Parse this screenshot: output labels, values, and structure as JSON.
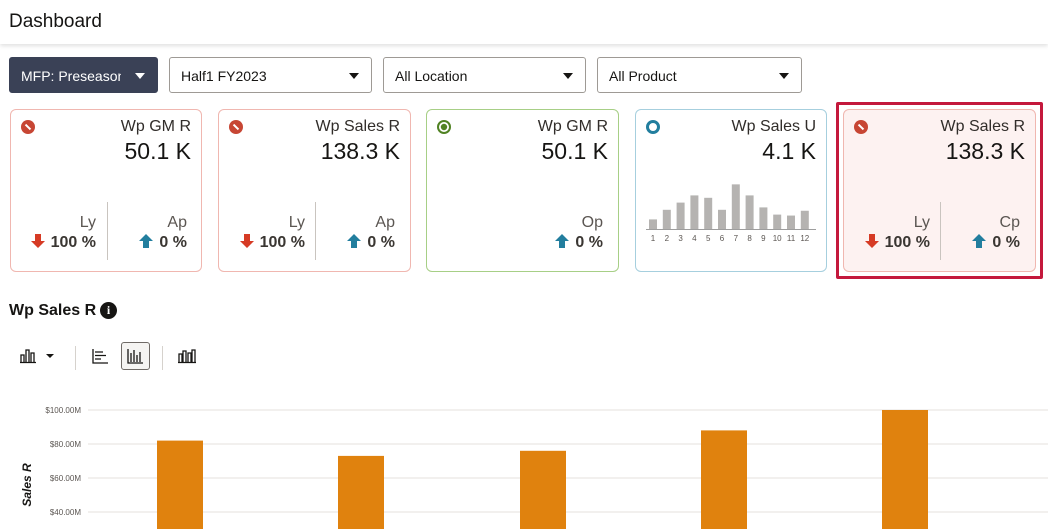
{
  "page": {
    "title": "Dashboard"
  },
  "filters": {
    "plan": "MFP: Preseason",
    "period": "Half1 FY2023",
    "location": "All Location",
    "product": "All Product"
  },
  "tiles": [
    {
      "name": "Wp GM R",
      "value": "50.1 K",
      "status": "no-entry-red",
      "color": "#c74634",
      "comparisons": [
        {
          "label": "Ly",
          "pct": "100 %",
          "dir": "down"
        },
        {
          "label": "Ap",
          "pct": "0 %",
          "dir": "up"
        }
      ]
    },
    {
      "name": "Wp Sales R",
      "value": "138.3 K",
      "status": "no-entry-red",
      "color": "#c74634",
      "comparisons": [
        {
          "label": "Ly",
          "pct": "100 %",
          "dir": "down"
        },
        {
          "label": "Ap",
          "pct": "0 %",
          "dir": "up"
        }
      ]
    },
    {
      "name": "Wp GM R",
      "value": "50.1 K",
      "status": "target-green",
      "color": "#508223",
      "comparisons": [
        {
          "label": "Op",
          "pct": "0 %",
          "dir": "up"
        }
      ]
    },
    {
      "name": "Wp Sales U",
      "value": "4.1 K",
      "status": "ring-teal",
      "color": "#227e9e",
      "sparkline": {
        "labels": [
          "1",
          "2",
          "3",
          "4",
          "5",
          "6",
          "7",
          "8",
          "9",
          "10",
          "11",
          "12"
        ],
        "values": [
          0.2,
          0.4,
          0.55,
          0.7,
          0.65,
          0.4,
          0.93,
          0.7,
          0.45,
          0.3,
          0.28,
          0.38
        ]
      }
    },
    {
      "name": "Wp Sales R",
      "value": "138.3 K",
      "status": "no-entry-red",
      "color": "#c74634",
      "selected": true,
      "comparisons": [
        {
          "label": "Ly",
          "pct": "100 %",
          "dir": "down"
        },
        {
          "label": "Cp",
          "pct": "0 %",
          "dir": "up"
        }
      ]
    }
  ],
  "section": {
    "title": "Wp Sales R",
    "info_icon": "i"
  },
  "toolbar": {
    "items": [
      "bar-chart-dropdown-icon",
      "horizontal-bar-icon",
      "vertical-bar-icon",
      "grouped-bar-icon"
    ],
    "active": "vertical-bar-icon"
  },
  "chart_data": {
    "type": "bar",
    "ylabel": "Sales R",
    "y_ticks": [
      "$100.00M",
      "$80.00M",
      "$60.00M",
      "$40.00M"
    ],
    "ylim": [
      30,
      100
    ],
    "values": [
      82,
      73,
      76,
      88,
      100
    ],
    "color": "#e0820e"
  }
}
